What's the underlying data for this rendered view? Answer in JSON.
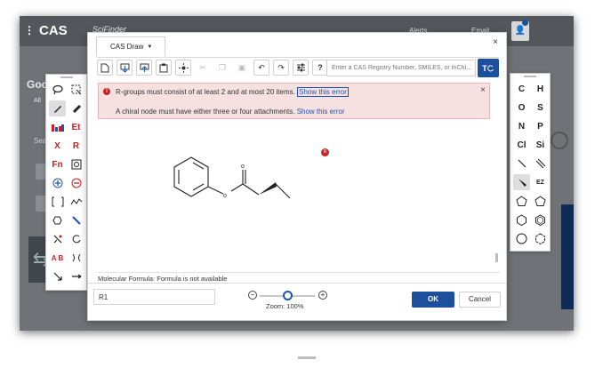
{
  "background_app": {
    "logo": "CAS",
    "product": "SciFinder",
    "util_links": [
      "Alerts",
      "Email"
    ],
    "left_fragment": "Goo",
    "sub_fragment": "All",
    "search_fragment": "Sea"
  },
  "dialog": {
    "tab_label": "CAS Draw",
    "close_label": "×",
    "search_placeholder": "Enter a CAS Registry Number, SMILES, or InChI...",
    "go_label": "T",
    "alerts": {
      "line1": "R-groups must consist of at least 2 and at most 20 items.",
      "line1_link": "Show this error",
      "line2": "A chiral node must have either three or four attachments.",
      "line2_link": "Show this error",
      "close": "×"
    },
    "error_marker": "R",
    "formula_text": "Molecular Formula: Formula is not available",
    "rgroup_value": "R1",
    "zoom": {
      "minus": "−",
      "plus": "+",
      "label": "Zoom: 100%",
      "value_percent": 100
    },
    "ok_label": "OK",
    "cancel_label": "Cancel"
  },
  "toolbar_icons": [
    "new-document-icon",
    "import-icon",
    "export-icon",
    "clipboard-icon",
    "center-icon",
    "cut-icon",
    "copy-icon",
    "paste-icon",
    "undo-icon",
    "redo-icon",
    "settings-sliders-icon",
    "help-icon"
  ],
  "left_palette": [
    [
      "lasso-icon",
      "marquee-select-icon"
    ],
    [
      "pencil-icon",
      "eraser-icon"
    ],
    [
      "periodic-table-icon",
      "Et"
    ],
    [
      "X",
      "R"
    ],
    [
      "Fn",
      "template-icon"
    ],
    [
      "positive-charge-icon",
      "negative-charge-icon"
    ],
    [
      "bracket-icon",
      "chain-icon"
    ],
    [
      "ring-fusion-icon",
      "bond-stereo-icon"
    ],
    [
      "reaction-map-icon",
      "rotate-icon"
    ],
    [
      "A B",
      "mirror-icon"
    ],
    [
      "arrow-diagonal-icon",
      "arrow-right-icon"
    ]
  ],
  "right_palette": [
    [
      "C",
      "H"
    ],
    [
      "O",
      "S"
    ],
    [
      "N",
      "P"
    ],
    [
      "Cl",
      "Si"
    ],
    [
      "single-bond-icon",
      "double-bond-icon"
    ],
    [
      "wedge-bond-icon",
      "EZ"
    ],
    [
      "cyclopentane-icon",
      "cyclopentane-alt-icon"
    ],
    [
      "cyclohexane-icon",
      "benzene-icon"
    ],
    [
      "cycloheptane-icon",
      "cyclohexane-alt-icon"
    ]
  ]
}
